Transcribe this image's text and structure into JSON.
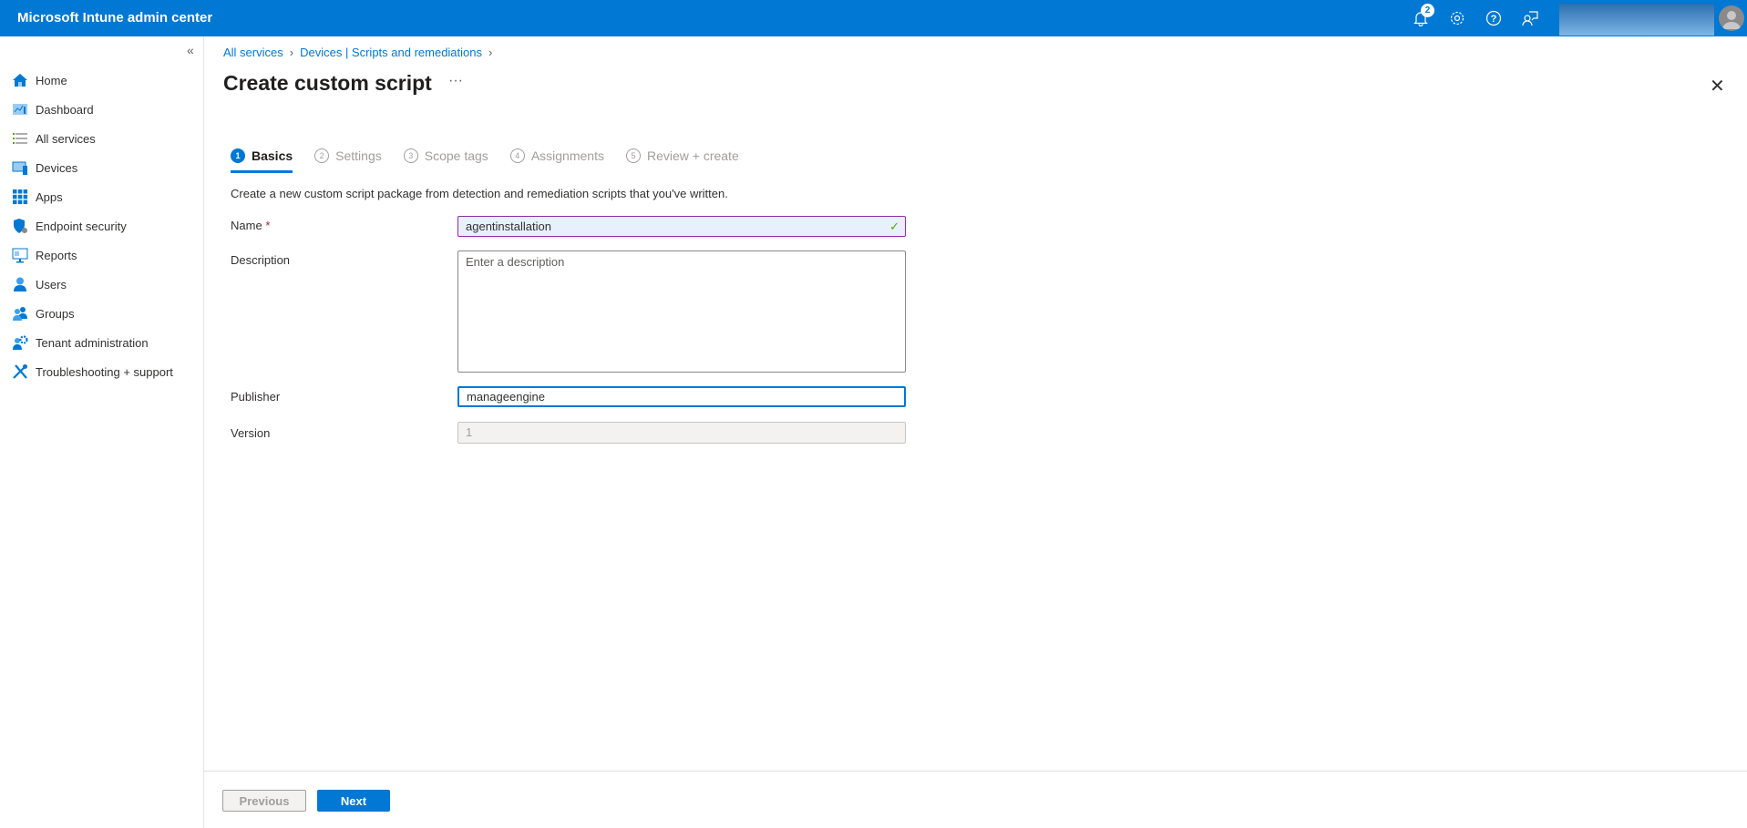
{
  "header": {
    "title": "Microsoft Intune admin center",
    "notification_count": "2"
  },
  "sidebar": {
    "items": [
      {
        "label": "Home",
        "icon": "home-icon"
      },
      {
        "label": "Dashboard",
        "icon": "dashboard-icon"
      },
      {
        "label": "All services",
        "icon": "list-icon"
      },
      {
        "label": "Devices",
        "icon": "devices-icon"
      },
      {
        "label": "Apps",
        "icon": "apps-icon"
      },
      {
        "label": "Endpoint security",
        "icon": "shield-icon"
      },
      {
        "label": "Reports",
        "icon": "reports-icon"
      },
      {
        "label": "Users",
        "icon": "user-icon"
      },
      {
        "label": "Groups",
        "icon": "groups-icon"
      },
      {
        "label": "Tenant administration",
        "icon": "tenant-admin-icon"
      },
      {
        "label": "Troubleshooting + support",
        "icon": "tools-icon"
      }
    ]
  },
  "breadcrumb": [
    "All services",
    "Devices | Scripts and remediations"
  ],
  "page": {
    "title": "Create custom script",
    "more": "···"
  },
  "steps": [
    {
      "num": "1",
      "label": "Basics"
    },
    {
      "num": "2",
      "label": "Settings"
    },
    {
      "num": "3",
      "label": "Scope tags"
    },
    {
      "num": "4",
      "label": "Assignments"
    },
    {
      "num": "5",
      "label": "Review + create"
    }
  ],
  "form": {
    "intro": "Create a new custom script package from detection and remediation scripts that you've written.",
    "name_label": "Name",
    "required_mark": "*",
    "name_value": "agentinstallation",
    "description_label": "Description",
    "description_placeholder": "Enter a description",
    "publisher_label": "Publisher",
    "publisher_value": "manageengine",
    "version_label": "Version",
    "version_value": "1"
  },
  "footer": {
    "previous": "Previous",
    "next": "Next"
  }
}
